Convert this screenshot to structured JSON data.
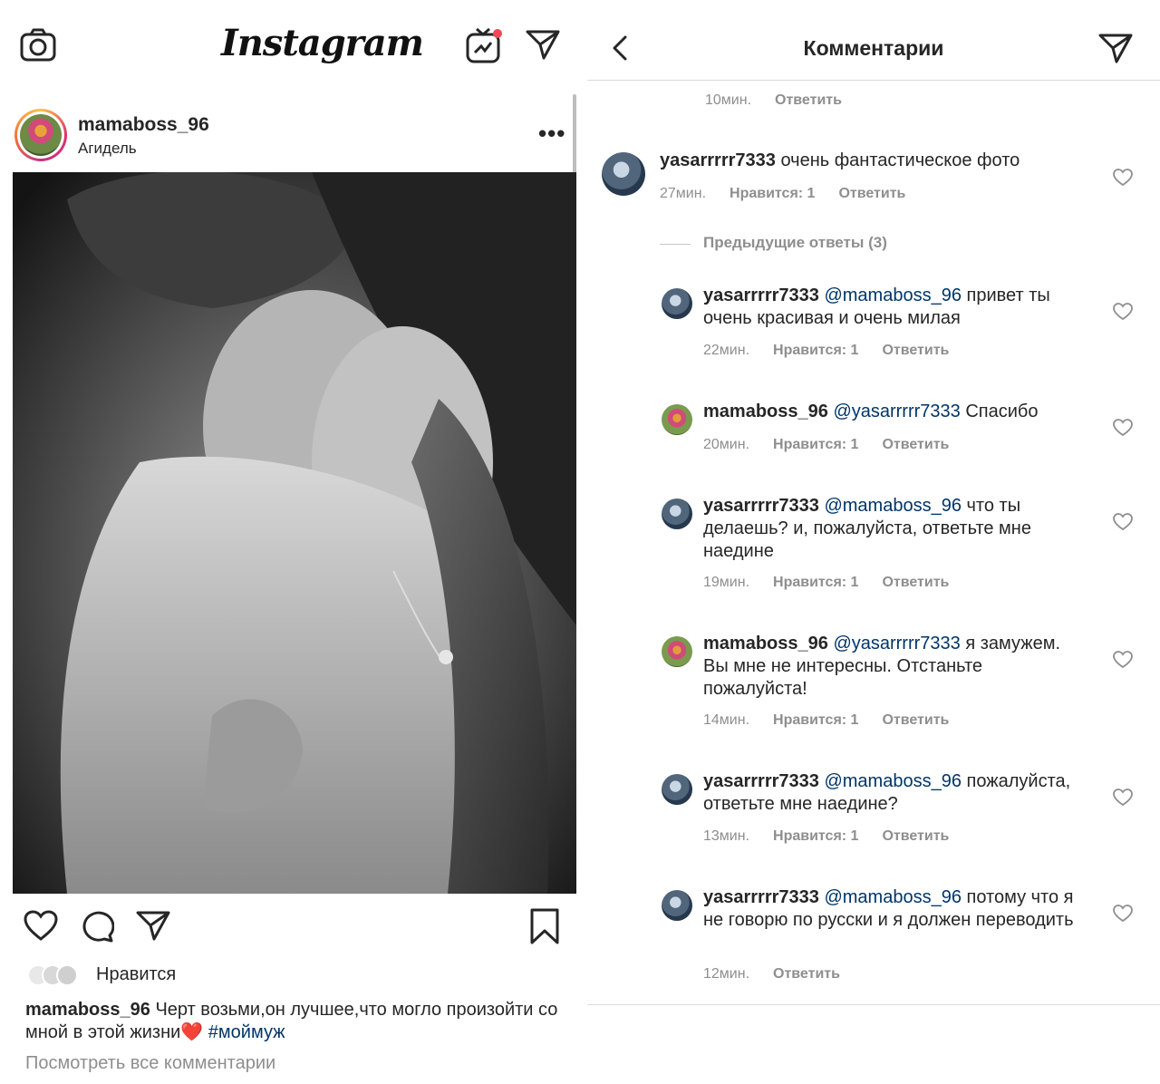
{
  "left": {
    "app_logo": "Instagram",
    "post": {
      "username": "mamaboss_96",
      "location": "Агидель",
      "more_label": "•••",
      "likes_label": "Нравится",
      "caption_user": "mamaboss_96",
      "caption_text": "Черт возьми,он лучшее,что могло произойти со мной в этой жизни",
      "caption_emoji": "❤️",
      "caption_hashtag": "#моймуж",
      "view_all_comments": "Посмотреть все комментарии"
    },
    "icons": {
      "camera": "camera-icon",
      "igtv": "igtv-icon",
      "direct": "paper-plane-icon",
      "like": "heart-icon",
      "comment": "comment-icon",
      "share": "paper-plane-icon",
      "save": "bookmark-icon"
    },
    "colors": {
      "notification_dot": "#ed4956",
      "hashtag": "#003569"
    }
  },
  "right": {
    "title": "Комментарии",
    "top_meta": {
      "time": "10мин.",
      "reply": "Ответить"
    },
    "main_comment": {
      "username": "yasarrrrr7333",
      "text": "очень фантастическое фото",
      "time": "27мин.",
      "likes": "Нравится: 1",
      "reply": "Ответить"
    },
    "previous_replies": "Предыдущие ответы (3)",
    "replies": [
      {
        "username": "yasarrrrr7333",
        "mention": "@mamaboss_96",
        "text": "привет ты очень красивая и очень милая",
        "time": "22мин.",
        "likes": "Нравится: 1",
        "reply": "Ответить"
      },
      {
        "username": "mamaboss_96",
        "mention": "@yasarrrrr7333",
        "text": "Спасибо",
        "time": "20мин.",
        "likes": "Нравится: 1",
        "reply": "Ответить"
      },
      {
        "username": "yasarrrrr7333",
        "mention": "@mamaboss_96",
        "text": "что ты делаешь? и, пожалуйста, ответьте мне наедине",
        "time": "19мин.",
        "likes": "Нравится: 1",
        "reply": "Ответить"
      },
      {
        "username": "mamaboss_96",
        "mention": "@yasarrrrr7333",
        "text": "я замужем. Вы мне не интересны. Отстаньте пожалуйста!",
        "time": "14мин.",
        "likes": "Нравится: 1",
        "reply": "Ответить"
      },
      {
        "username": "yasarrrrr7333",
        "mention": "@mamaboss_96",
        "text": "пожалуйста, ответьте мне наедине?",
        "time": "13мин.",
        "likes": "Нравится: 1",
        "reply": "Ответить"
      },
      {
        "username": "yasarrrrr7333",
        "mention": "@mamaboss_96",
        "text": "потому что я не говорю по русски и я должен переводить",
        "time": "12мин.",
        "likes": "",
        "reply": "Ответить"
      }
    ]
  }
}
